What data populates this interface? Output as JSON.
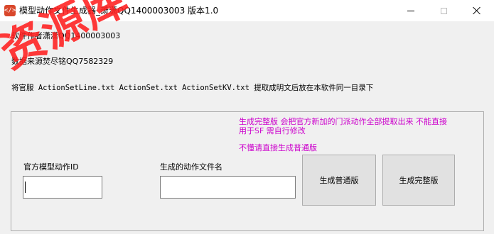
{
  "window": {
    "icon_glyph": "</>",
    "title": "模型动作文件生成器_萧潇QQ1400003003  版本1.0"
  },
  "info": {
    "author": "软件作者潇潇QQ1400003003",
    "data_source": "数据来源焚尽铭QQ7582329",
    "instruction": "将官服 ActionSetLine.txt ActionSet.txt ActionSetKV.txt 提取成明文后放在本软件同一目录下"
  },
  "notes": {
    "full_note": "生成完整版 会把官方新加的门派动作全部提取出来 不能直接用于SF 需自行修改",
    "normal_note": "不懂请直接生成普通版"
  },
  "fields": {
    "model_id_label": "官方模型动作ID",
    "model_id_value": "",
    "file_name_label": "生成的动作文件名",
    "file_name_value": ""
  },
  "buttons": {
    "normal": "生成普通版",
    "full": "生成完整版"
  },
  "watermark": {
    "text": "资源库"
  },
  "colors": {
    "note_text": "#cc00cc",
    "watermark": "#ff1f1f",
    "window_bg": "#f0f0f0",
    "titlebar_bg": "#ffffff"
  },
  "icons": {
    "app": "code-icon",
    "minimize": "minimize-icon",
    "maximize": "maximize-icon",
    "close": "close-icon"
  }
}
